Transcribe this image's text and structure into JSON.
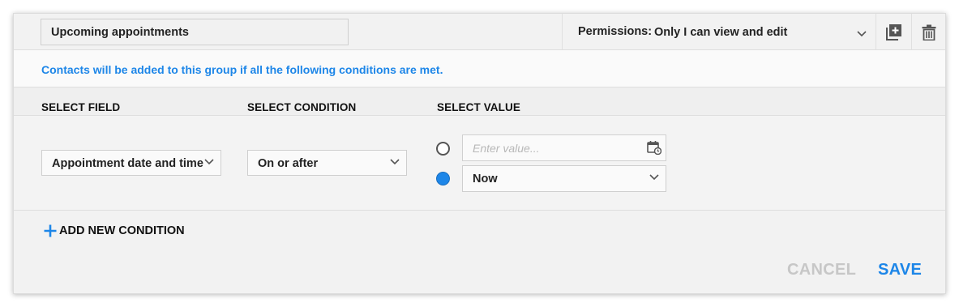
{
  "header": {
    "group_name": "Upcoming appointments",
    "permissions_label": "Permissions:",
    "permissions_value": "Only I can view and edit",
    "duplicate_icon": "duplicate-icon",
    "delete_icon": "trash-icon"
  },
  "info": {
    "text": "Contacts will be added to this group if all the following conditions are met."
  },
  "columns": {
    "field": "SELECT FIELD",
    "condition": "SELECT CONDITION",
    "value": "SELECT VALUE"
  },
  "condition": {
    "field": "Appointment date and time",
    "operator": "On or after",
    "value_placeholder": "Enter value...",
    "value_input": "",
    "relative_value": "Now",
    "selected_option": "relative",
    "calendar_icon": "calendar-icon"
  },
  "actions": {
    "add_condition": "ADD NEW CONDITION",
    "cancel": "CANCEL",
    "save": "SAVE"
  },
  "colors": {
    "accent": "#1d86e8",
    "disabled": "#c7c7c7",
    "background": "#f2f2f2"
  }
}
